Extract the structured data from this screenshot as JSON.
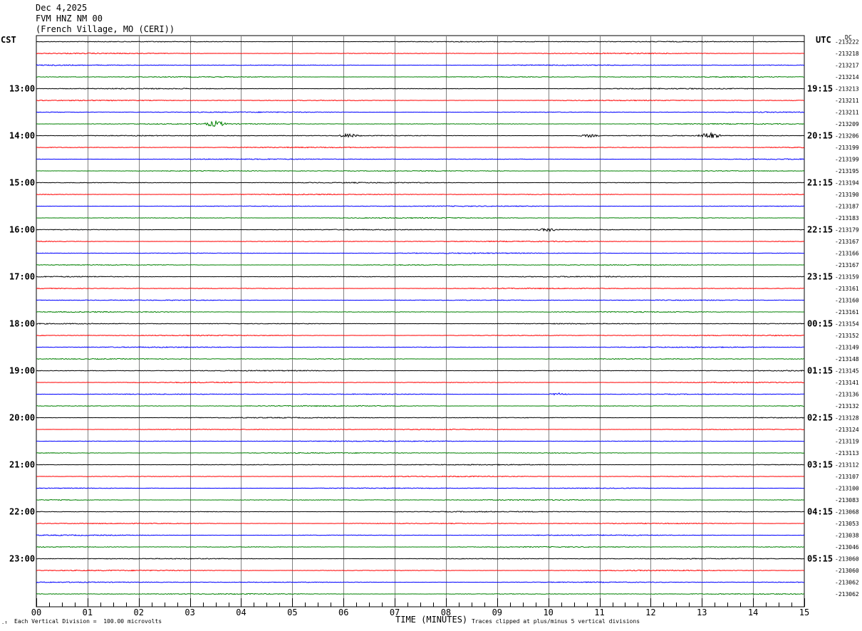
{
  "header": {
    "date": "Dec 4,2025",
    "station": "FVM HNZ NM 00",
    "location": "(French Village, MO (CERI))"
  },
  "left_timezone": "CST",
  "right_timezone": "UTC",
  "dc_label": "DC",
  "footer": {
    "scale_note": "Each Vertical Division =  100.00 microvolts",
    "xlabel": "TIME (MINUTES)",
    "clip_note": "Traces clipped at plus/minus 5 vertical divisions"
  },
  "colors": {
    "trace_cycle": [
      "#000000",
      "#ff0000",
      "#0000ff",
      "#008000"
    ],
    "grid": "#808080"
  },
  "chart_data": {
    "type": "line",
    "title": "FVM HNZ NM 00",
    "xlabel": "TIME (MINUTES)",
    "xlim": [
      0,
      15
    ],
    "x_ticks": [
      "00",
      "01",
      "02",
      "03",
      "04",
      "05",
      "06",
      "07",
      "08",
      "09",
      "10",
      "11",
      "12",
      "13",
      "14",
      "15"
    ],
    "left_hour_labels": [
      "13:00",
      "14:00",
      "15:00",
      "16:00",
      "17:00",
      "18:00",
      "19:00",
      "20:00",
      "21:00",
      "22:00",
      "23:00"
    ],
    "right_hour_labels": [
      "19:15",
      "20:15",
      "21:15",
      "22:15",
      "23:15",
      "00:15",
      "01:15",
      "02:15",
      "03:15",
      "04:15",
      "05:15"
    ],
    "dc_offsets": [
      "213222",
      "213218",
      "213217",
      "213214",
      "213213",
      "213211",
      "213211",
      "213209",
      "213206",
      "213199",
      "213199",
      "213195",
      "213194",
      "213190",
      "213187",
      "213183",
      "213179",
      "213167",
      "213166",
      "213167",
      "213159",
      "213161",
      "213160",
      "213161",
      "213154",
      "213152",
      "213149",
      "213148",
      "213145",
      "213141",
      "213136",
      "213132",
      "213128",
      "213124",
      "213119",
      "213113",
      "213112",
      "213107",
      "213100",
      "213083",
      "213068",
      "213053",
      "213038",
      "213046",
      "213060",
      "213060",
      "213062",
      "213062"
    ],
    "events": [
      {
        "trace": 7,
        "minute": 3.5,
        "amplitude": 4.0
      },
      {
        "trace": 8,
        "minute": 6.1,
        "amplitude": 2.5
      },
      {
        "trace": 8,
        "minute": 10.8,
        "amplitude": 2.0
      },
      {
        "trace": 8,
        "minute": 13.15,
        "amplitude": 4.5
      },
      {
        "trace": 16,
        "minute": 10.0,
        "amplitude": 2.0
      },
      {
        "trace": 30,
        "minute": 10.2,
        "amplitude": 1.5
      }
    ]
  }
}
